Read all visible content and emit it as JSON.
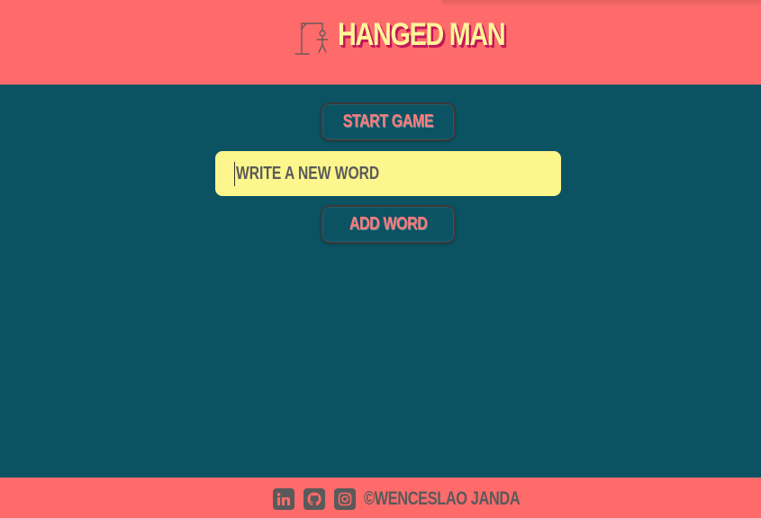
{
  "header": {
    "title": "Hanged Man",
    "logo_icon": "gallows-stickman-icon"
  },
  "main": {
    "start_button": "Start Game",
    "word_input": {
      "placeholder": "Write a new word",
      "value": ""
    },
    "add_button": "Add Word"
  },
  "footer": {
    "social_icons": [
      "linkedin-icon",
      "github-icon",
      "instagram-icon"
    ],
    "copyright": "©Wenceslao Janda"
  },
  "colors": {
    "header_bg": "#ff6b6b",
    "main_bg": "#0b5263",
    "title_fill": "#fff59a",
    "title_shadow": "#c2185b",
    "button_text": "#ff7a7a",
    "input_bg": "#fdf68d",
    "footer_text": "#5a5a5a"
  }
}
